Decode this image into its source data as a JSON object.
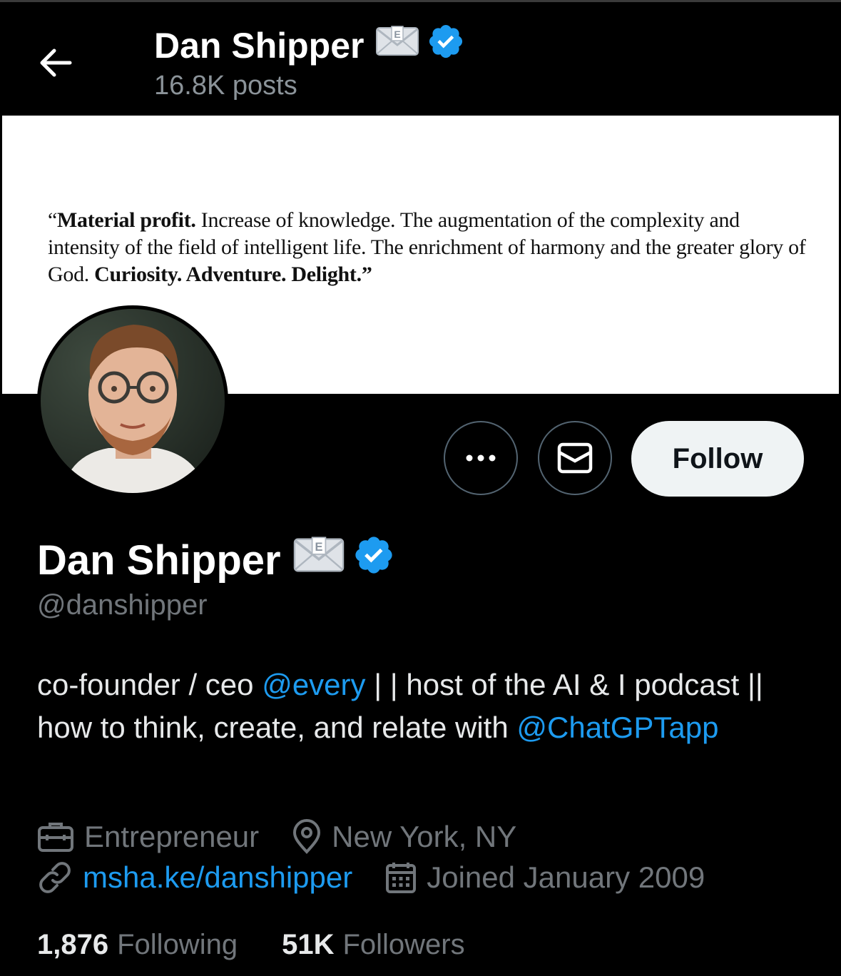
{
  "header": {
    "name": "Dan Shipper",
    "posts": "16.8K posts"
  },
  "banner": {
    "quote_open": "“",
    "bold1": "Material profit.",
    "text1": " Increase of knowledge. The augmentation of the complexity and intensity of the field of intelligent life. The enrichment of harmony and the greater glory of God. ",
    "bold2": "Curiosity. Adventure. Delight.",
    "quote_close": "”"
  },
  "actions": {
    "follow_label": "Follow"
  },
  "profile": {
    "name": "Dan Shipper",
    "handle": "@danshipper",
    "bio": {
      "part1": "co-founder / ceo ",
      "mention1": "@every",
      "part2": " | | host of the AI & I podcast || how to think, create, and relate with ",
      "mention2": "@ChatGPTapp"
    },
    "occupation": "Entrepreneur",
    "location": "New York, NY",
    "website": "msha.ke/danshipper",
    "joined": "Joined January 2009"
  },
  "stats": {
    "following_count": "1,876",
    "following_label": "Following",
    "followers_count": "51K",
    "followers_label": "Followers"
  },
  "colors": {
    "accent": "#1d9bf0",
    "verified": "#1d9bf0",
    "muted": "#71767b"
  },
  "icons": [
    "back-arrow-icon",
    "envelope-emoji-icon",
    "verified-badge-icon",
    "more-icon",
    "message-icon",
    "briefcase-icon",
    "location-pin-icon",
    "link-icon",
    "calendar-icon"
  ]
}
